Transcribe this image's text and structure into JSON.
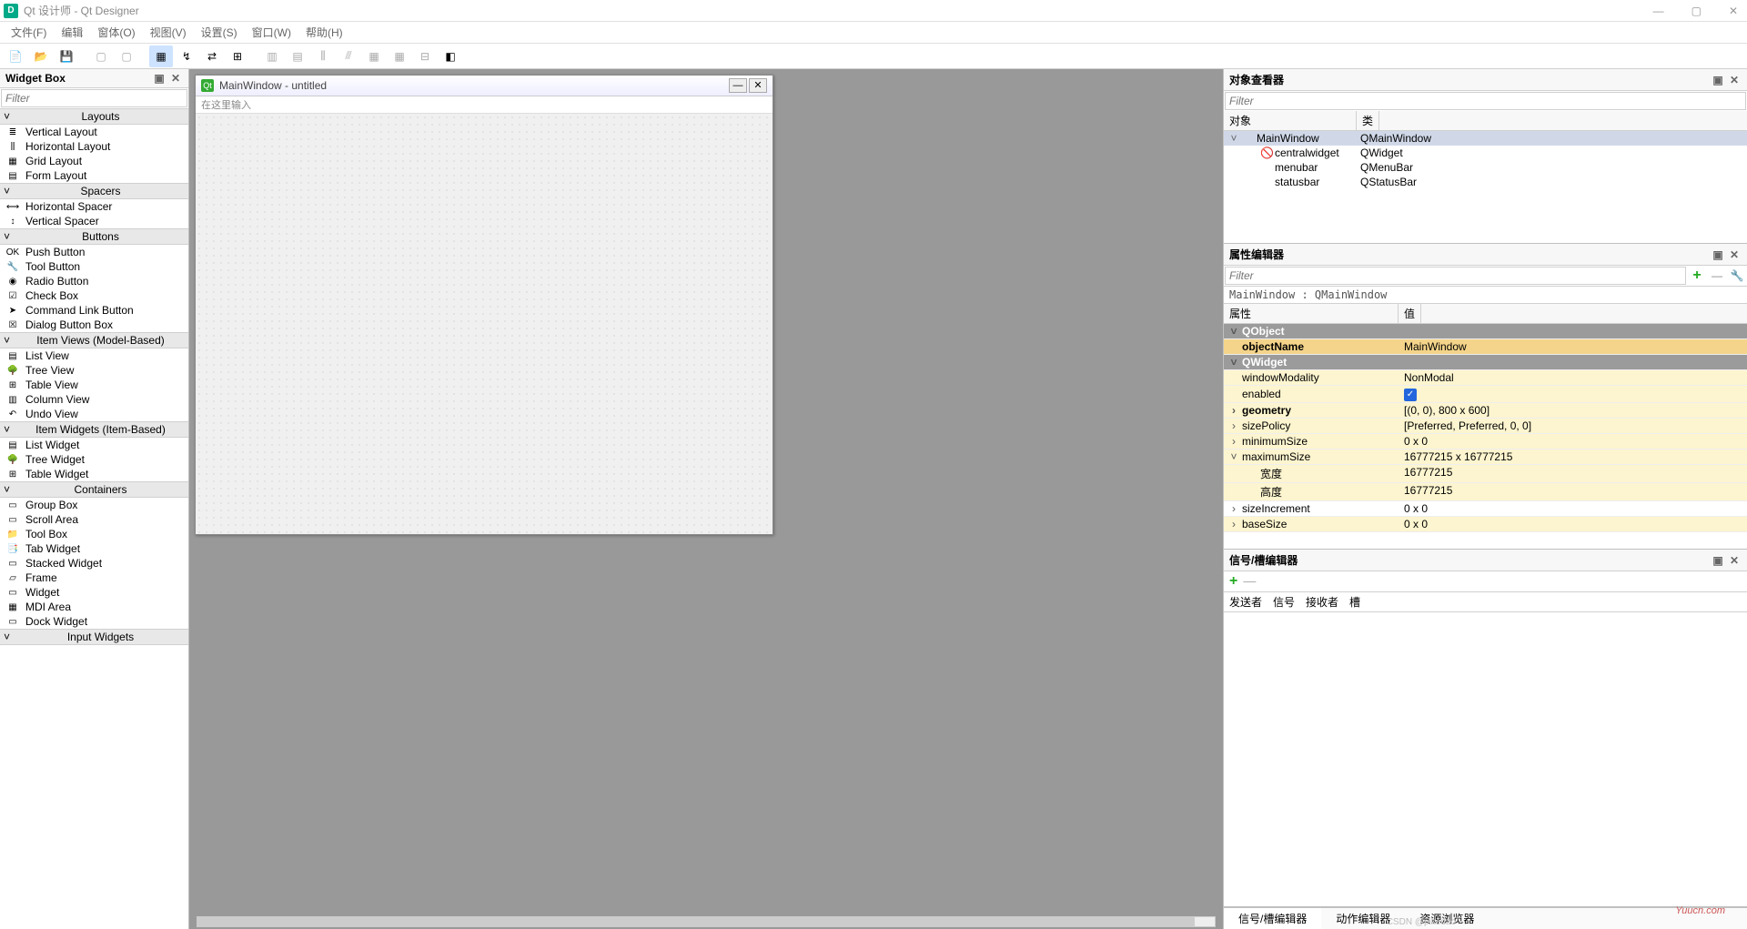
{
  "window": {
    "title": "Qt 设计师 - Qt Designer",
    "appIconLetter": "D",
    "controls": {
      "min": "—",
      "max": "▢",
      "close": "✕"
    }
  },
  "menubar": [
    "文件(F)",
    "编辑",
    "窗体(O)",
    "视图(V)",
    "设置(S)",
    "窗口(W)",
    "帮助(H)"
  ],
  "widgetBox": {
    "title": "Widget Box",
    "filterPlaceholder": "Filter",
    "categories": [
      {
        "name": "Layouts",
        "items": [
          "Vertical Layout",
          "Horizontal Layout",
          "Grid Layout",
          "Form Layout"
        ]
      },
      {
        "name": "Spacers",
        "items": [
          "Horizontal Spacer",
          "Vertical Spacer"
        ]
      },
      {
        "name": "Buttons",
        "items": [
          "Push Button",
          "Tool Button",
          "Radio Button",
          "Check Box",
          "Command Link Button",
          "Dialog Button Box"
        ]
      },
      {
        "name": "Item Views (Model-Based)",
        "items": [
          "List View",
          "Tree View",
          "Table View",
          "Column View",
          "Undo View"
        ]
      },
      {
        "name": "Item Widgets (Item-Based)",
        "items": [
          "List Widget",
          "Tree Widget",
          "Table Widget"
        ]
      },
      {
        "name": "Containers",
        "items": [
          "Group Box",
          "Scroll Area",
          "Tool Box",
          "Tab Widget",
          "Stacked Widget",
          "Frame",
          "Widget",
          "MDI Area",
          "Dock Widget"
        ]
      },
      {
        "name": "Input Widgets",
        "items": []
      }
    ]
  },
  "form": {
    "title": "MainWindow - untitled",
    "qtIcon": "Qt",
    "menubarHint": "在这里输入"
  },
  "objectInspector": {
    "title": "对象查看器",
    "filterPlaceholder": "Filter",
    "cols": [
      "对象",
      "类"
    ],
    "rows": [
      {
        "name": "MainWindow",
        "class": "QMainWindow",
        "depth": 0,
        "expander": "˅",
        "selected": true
      },
      {
        "name": "centralwidget",
        "class": "QWidget",
        "depth": 1,
        "icon": "🚫"
      },
      {
        "name": "menubar",
        "class": "QMenuBar",
        "depth": 1
      },
      {
        "name": "statusbar",
        "class": "QStatusBar",
        "depth": 1
      }
    ]
  },
  "propertyEditor": {
    "title": "属性编辑器",
    "filterPlaceholder": "Filter",
    "info": "MainWindow : QMainWindow",
    "cols": [
      "属性",
      "值"
    ],
    "rows": [
      {
        "type": "group",
        "name": "QObject"
      },
      {
        "name": "objectName",
        "value": "MainWindow",
        "style": "highlight",
        "bold": true
      },
      {
        "type": "group",
        "name": "QWidget"
      },
      {
        "name": "windowModality",
        "value": "NonModal",
        "style": "yellow"
      },
      {
        "name": "enabled",
        "value": "",
        "checkbox": true,
        "style": "yellow"
      },
      {
        "name": "geometry",
        "value": "[(0, 0), 800 x 600]",
        "style": "yellow",
        "exp": "›",
        "bold": true
      },
      {
        "name": "sizePolicy",
        "value": "[Preferred, Preferred, 0, 0]",
        "style": "yellow",
        "exp": "›"
      },
      {
        "name": "minimumSize",
        "value": "0 x 0",
        "style": "yellow",
        "exp": "›"
      },
      {
        "name": "maximumSize",
        "value": "16777215 x 16777215",
        "style": "yellow",
        "exp": "˅"
      },
      {
        "name": "宽度",
        "value": "16777215",
        "style": "yellow",
        "indent": 1
      },
      {
        "name": "高度",
        "value": "16777215",
        "style": "yellow",
        "indent": 1
      },
      {
        "name": "sizeIncrement",
        "value": "0 x 0",
        "exp": "›"
      },
      {
        "name": "baseSize",
        "value": "0 x 0",
        "style": "yellow",
        "exp": "›"
      }
    ]
  },
  "signalEditor": {
    "title": "信号/槽编辑器",
    "cols": [
      "发送者",
      "信号",
      "接收者",
      "槽"
    ]
  },
  "bottomTabs": [
    "信号/槽编辑器",
    "动作编辑器",
    "资源浏览器"
  ],
  "watermark": "Yuucn.com",
  "watermark2": "CSDN @pikeduo"
}
